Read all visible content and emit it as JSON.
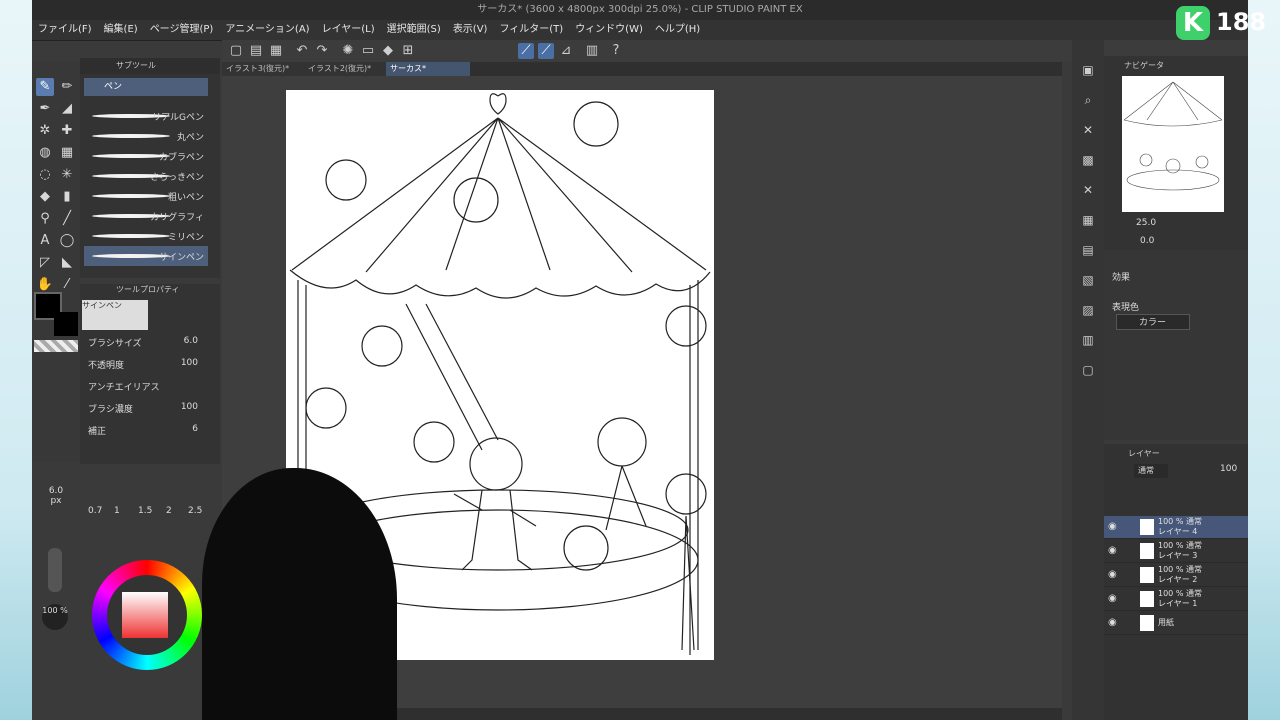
{
  "window": {
    "title": "サーカス* (3600 x 4800px 300dpi 25.0%) - CLIP STUDIO PAINT EX"
  },
  "menu": [
    "ファイル(F)",
    "編集(E)",
    "ページ管理(P)",
    "アニメーション(A)",
    "レイヤー(L)",
    "選択範囲(S)",
    "表示(V)",
    "フィルター(T)",
    "ウィンドウ(W)",
    "ヘルプ(H)"
  ],
  "doc_tabs": [
    "イラスト3(復元)*",
    "イラスト2(復元)*",
    "サーカス*"
  ],
  "subtool": {
    "header": "サブツール",
    "tab": "ペン",
    "brushes": [
      "リアルGペン",
      "丸ペン",
      "カブラペン",
      "さらっきペン",
      "粗いペン",
      "カリグラフィ",
      "ミリペン",
      "サインペン"
    ],
    "selected": "サインペン"
  },
  "tool_property": {
    "header": "ツールプロパティ",
    "current": "サインペン",
    "rows": [
      {
        "label": "ブラシサイズ",
        "value": "6.0"
      },
      {
        "label": "不透明度",
        "value": "100"
      },
      {
        "label": "アンチエイリアス",
        "value": ""
      },
      {
        "label": "ブラシ濃度",
        "value": "100"
      },
      {
        "label": "補正",
        "value": "6"
      }
    ]
  },
  "brush_size_readout": {
    "value": "6.0",
    "unit": "px"
  },
  "size_presets": [
    "0.7",
    "1",
    "1.5",
    "2",
    "2.5"
  ],
  "opacity_readout": "100 %",
  "navigator": {
    "header": "ナビゲータ",
    "zoom": "25.0",
    "rotation": "0.0"
  },
  "effect_panel": {
    "header": "効果",
    "expression_label": "表現色",
    "expression_value": "カラー"
  },
  "layer_panel": {
    "header": "レイヤー",
    "blend_mode": "通常",
    "opacity": "100",
    "layers": [
      {
        "mode": "100 % 通常",
        "name": "レイヤー 4",
        "selected": true
      },
      {
        "mode": "100 % 通常",
        "name": "レイヤー 3",
        "selected": false
      },
      {
        "mode": "100 % 通常",
        "name": "レイヤー 2",
        "selected": false
      },
      {
        "mode": "100 % 通常",
        "name": "レイヤー 1",
        "selected": false
      },
      {
        "mode": "",
        "name": "用紙",
        "selected": false
      }
    ]
  },
  "badge": {
    "letter": "K",
    "count": "188"
  },
  "colors": {
    "accent": "#5b7cb0",
    "app_bg": "#3a3a3a",
    "badge_green": "#3ed16b"
  }
}
